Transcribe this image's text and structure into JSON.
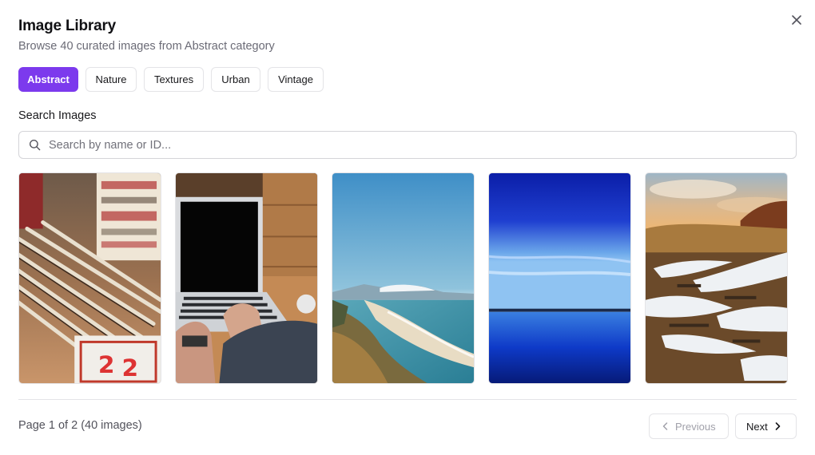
{
  "dialog": {
    "title": "Image Library",
    "subtitle": "Browse 40 curated images from Abstract category",
    "close_icon": "close-icon"
  },
  "categories": [
    {
      "label": "Abstract",
      "active": true
    },
    {
      "label": "Nature",
      "active": false
    },
    {
      "label": "Textures",
      "active": false
    },
    {
      "label": "Urban",
      "active": false
    },
    {
      "label": "Vintage",
      "active": false
    }
  ],
  "search": {
    "label": "Search Images",
    "placeholder": "Search by name or ID...",
    "value": "",
    "icon": "search-icon"
  },
  "images": [
    {
      "subject": "wooden rulers and vintage signs"
    },
    {
      "subject": "hands typing on laptop"
    },
    {
      "subject": "coastal beach from hillside"
    },
    {
      "subject": "deep blue sky over calm water"
    },
    {
      "subject": "sunset over snowy field"
    }
  ],
  "pagination": {
    "info": "Page 1 of 2 (40 images)",
    "previous_label": "Previous",
    "next_label": "Next",
    "previous_enabled": false,
    "next_enabled": true
  },
  "colors": {
    "accent": "#7c3aed",
    "border": "#e4e4e7",
    "muted_text": "#6b6b76"
  }
}
